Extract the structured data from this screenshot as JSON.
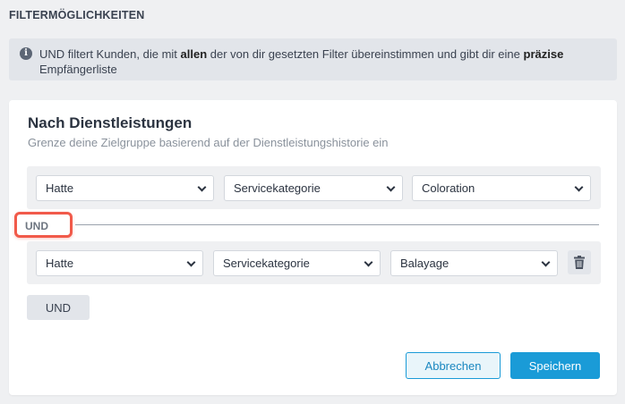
{
  "section": {
    "title": "FILTERMÖGLICHKEITEN"
  },
  "info": {
    "icon": "info-icon",
    "text_before": "UND filtert Kunden, die mit ",
    "bold1": "allen",
    "text_middle": " der von dir gesetzten Filter übereinstimmen und gibt dir eine ",
    "bold2": "präzise",
    "text_after": " Empfängerliste"
  },
  "card": {
    "title": "Nach Dienstleistungen",
    "subtitle": "Grenze deine Zielgruppe basierend auf der Dienstleistungshistorie ein",
    "connector_label": "UND",
    "rows": [
      {
        "condition": "Hatte",
        "field": "Servicekategorie",
        "value": "Coloration"
      },
      {
        "condition": "Hatte",
        "field": "Servicekategorie",
        "value": "Balayage"
      }
    ],
    "add_button": "UND",
    "cancel_button": "Abbrechen",
    "save_button": "Speichern"
  },
  "colors": {
    "primary": "#1a9bd7",
    "highlight": "#f15a4a",
    "background": "#eff0f2"
  }
}
